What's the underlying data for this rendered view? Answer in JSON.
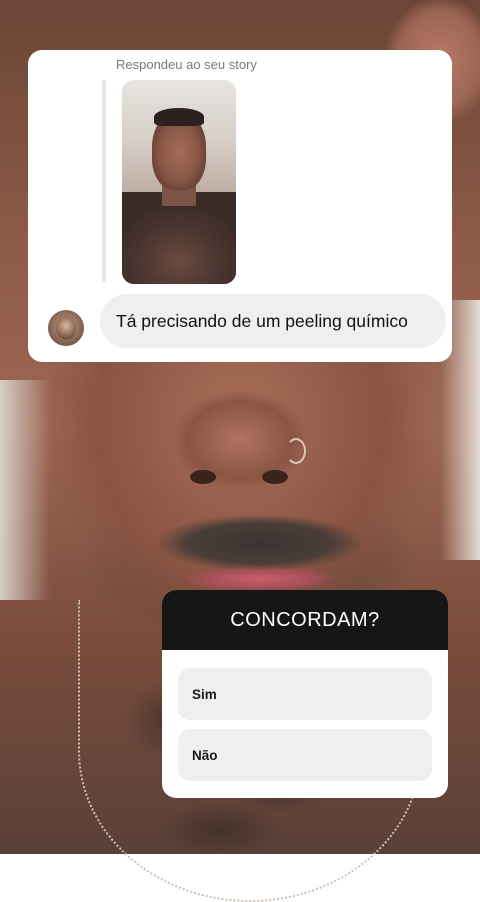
{
  "reply": {
    "header": "Respondeu ao seu story",
    "message": "Tá precisando de um peeling químico"
  },
  "poll": {
    "question": "CONCORDAM?",
    "options": [
      "Sim",
      "Não"
    ]
  },
  "icons": {
    "avatar": "profile-photo"
  },
  "colors": {
    "poll_header_bg": "#161616",
    "card_bg": "#ffffff",
    "bubble_bg": "#efefef"
  }
}
